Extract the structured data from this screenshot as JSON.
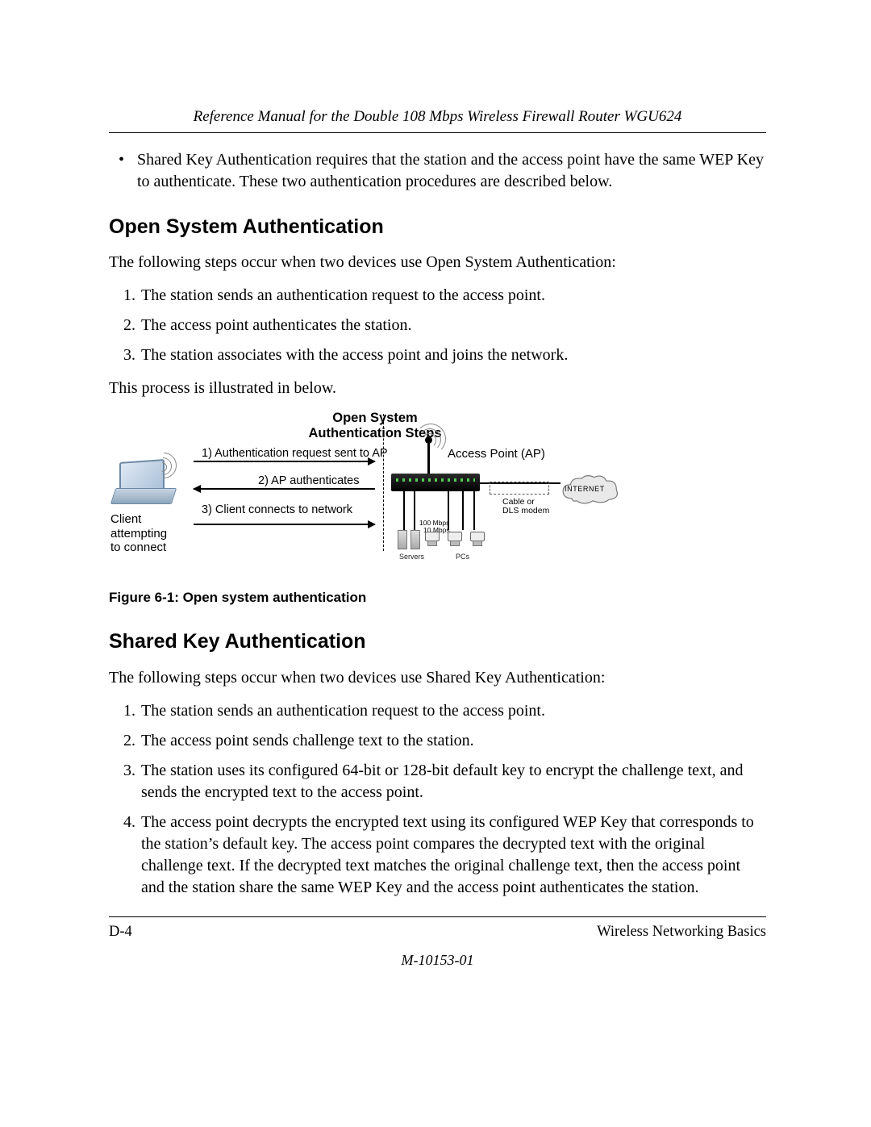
{
  "header": {
    "running": "Reference Manual for the Double 108 Mbps Wireless Firewall Router WGU624"
  },
  "intro_bullet": "Shared Key Authentication requires that the station and the access point have the same WEP Key to authenticate. These two authentication procedures are described below.",
  "open": {
    "heading": "Open System Authentication",
    "lead": "The following steps occur when two devices use Open System Authentication:",
    "steps": [
      "The station sends an authentication request to the access point.",
      "The access point authenticates the station.",
      "The station associates with the access point and joins the network."
    ],
    "tail": "This process is illustrated in below."
  },
  "figure": {
    "title_line1": "Open System",
    "title_line2": "Authentication Steps",
    "step1": "1) Authentication request sent to AP",
    "step2": "2) AP authenticates",
    "step3": "3) Client connects to network",
    "client": "Client\nattempting\nto connect",
    "ap": "Access Point (AP)",
    "modem": "Cable or\nDLS modem",
    "internet": "INTERNET",
    "servers": "Servers",
    "pcs": "PCs",
    "speed1": "100 Mbps",
    "speed2": "10 Mbps",
    "caption": "Figure 6-1:  Open system authentication"
  },
  "shared": {
    "heading": "Shared Key Authentication",
    "lead": "The following steps occur when two devices use Shared Key Authentication:",
    "steps": [
      "The station sends an authentication request to the access point.",
      "The access point sends challenge text to the station.",
      "The station uses its configured 64-bit or 128-bit default key to encrypt the challenge text, and sends the encrypted text to the access point.",
      "The access point decrypts the encrypted text using its configured WEP Key that corresponds to the station’s default key. The access point compares the decrypted text with the original challenge text. If the decrypted text matches the original challenge text, then the access point and the station share the same WEP Key and the access point authenticates the station."
    ]
  },
  "footer": {
    "page": "D-4",
    "section": "Wireless Networking Basics",
    "docnum": "M-10153-01"
  }
}
